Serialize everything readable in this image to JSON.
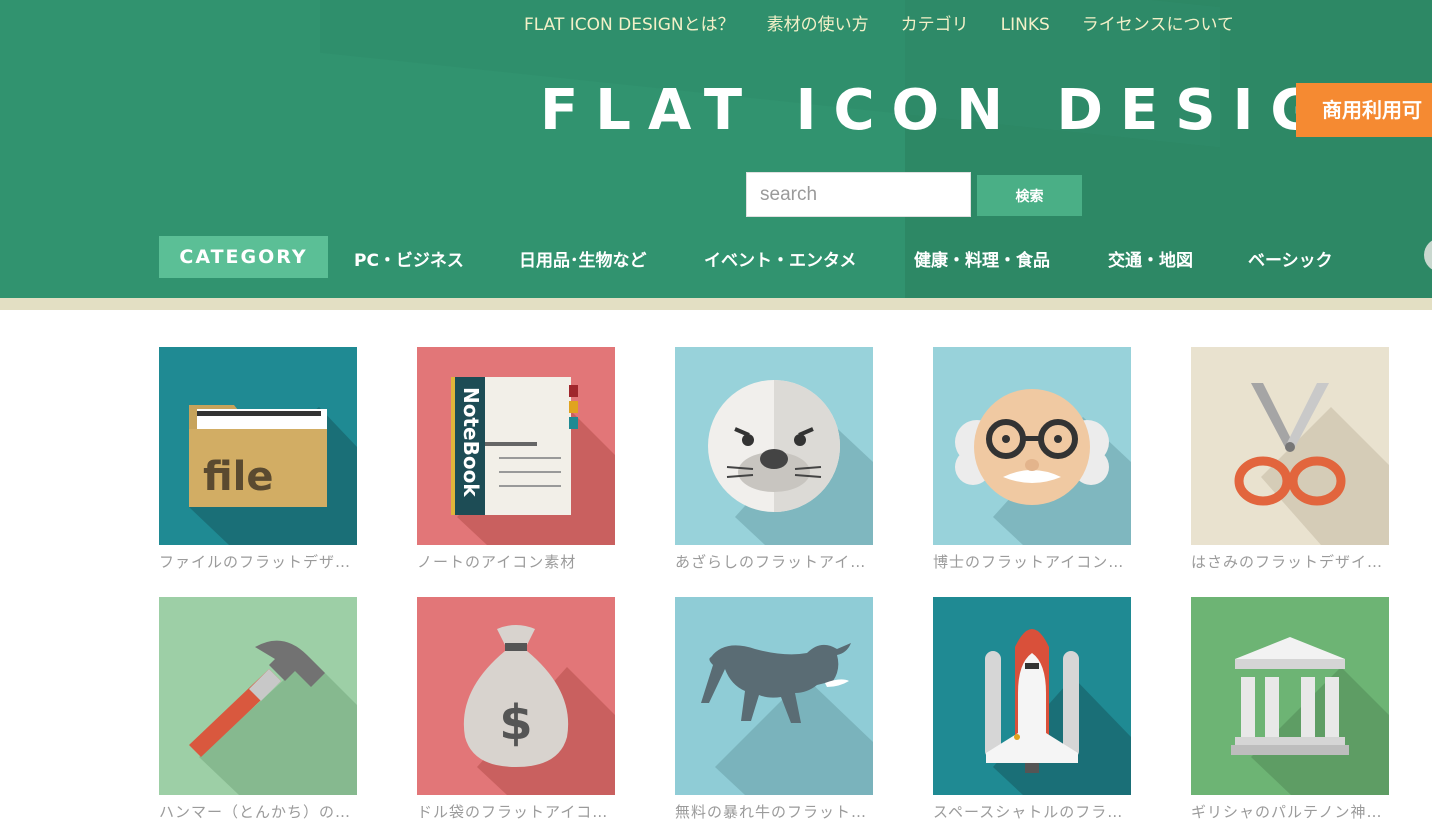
{
  "topnav": [
    {
      "label": "FLAT ICON DESIGNとは？"
    },
    {
      "label": "素材の使い方"
    },
    {
      "label": "カテゴリ"
    },
    {
      "label": "LINKS"
    },
    {
      "label": "ライセンスについて"
    }
  ],
  "site_title": "FLAT ICON DESIGN",
  "commercial_badge": "商用利用可",
  "search": {
    "placeholder": "search",
    "value": "",
    "button_label": "検索"
  },
  "category_nav": {
    "label": "CATEGORY",
    "items": [
      {
        "label": "PC・ビジネス"
      },
      {
        "label": "日用品･生物など"
      },
      {
        "label": "イベント・エンタメ"
      },
      {
        "label": "健康・料理・食品"
      },
      {
        "label": "交通・地図"
      },
      {
        "label": "ベーシック"
      }
    ]
  },
  "icons": [
    {
      "caption": "ファイルのフラットデザ…",
      "icon": "file-folder-icon",
      "bg": "#1f8a93"
    },
    {
      "caption": "ノートのアイコン素材",
      "icon": "notebook-icon",
      "bg": "#e27678",
      "book_text": "NoteBook"
    },
    {
      "caption": "あざらしのフラットアイ…",
      "icon": "seal-icon",
      "bg": "#98d2da"
    },
    {
      "caption": "博士のフラットアイコン…",
      "icon": "professor-icon",
      "bg": "#98d2da"
    },
    {
      "caption": "はさみのフラットデザイ…",
      "icon": "scissors-icon",
      "bg": "#e9e2cf"
    },
    {
      "caption": "ハンマー（とんかち）の…",
      "icon": "hammer-icon",
      "bg": "#9dcfa6"
    },
    {
      "caption": "ドル袋のフラットアイコ…",
      "icon": "money-bag-icon",
      "bg": "#e27678"
    },
    {
      "caption": "無料の暴れ牛のフラット…",
      "icon": "bull-icon",
      "bg": "#8fccd6"
    },
    {
      "caption": "スペースシャトルのフラ…",
      "icon": "space-shuttle-icon",
      "bg": "#1f8a93"
    },
    {
      "caption": "ギリシャのパルテノン神…",
      "icon": "parthenon-icon",
      "bg": "#6db474"
    }
  ],
  "file_text": "file",
  "colors": {
    "header": "#31936f",
    "accent": "#5bbf96",
    "badge": "#f58a32",
    "band": "#e3dfc3"
  }
}
